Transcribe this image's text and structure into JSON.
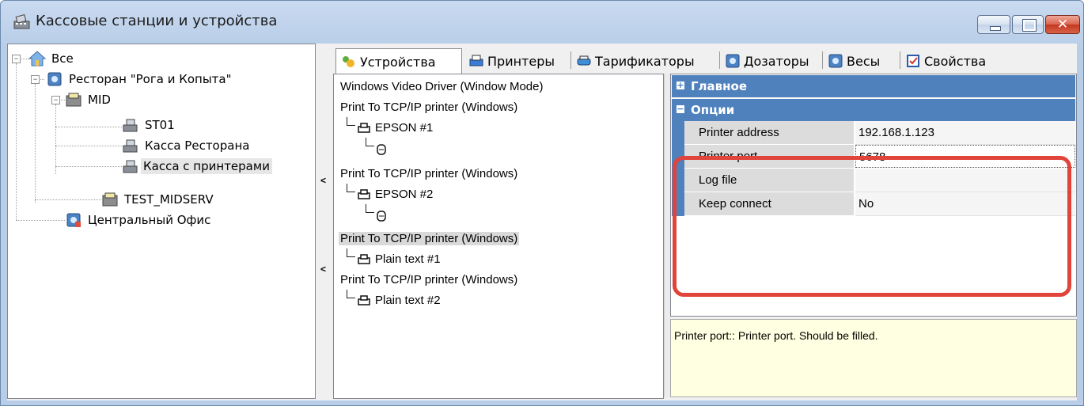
{
  "window": {
    "title": "Кассовые станции и устройства",
    "close_glyph": "✕"
  },
  "tree": {
    "items": [
      {
        "label": "Все"
      },
      {
        "label": "Ресторан \"Рога и Копыта\""
      },
      {
        "label": "MID"
      },
      {
        "label": "ST01"
      },
      {
        "label": "Касса Ресторана"
      },
      {
        "label": "Касса с принтерами"
      },
      {
        "label": "TEST_MIDSERV"
      },
      {
        "label": "Центральный Офис"
      }
    ],
    "expander_minus": "−"
  },
  "tabs": [
    {
      "label": "Устройства"
    },
    {
      "label": "Принтеры"
    },
    {
      "label": "Тарификаторы"
    },
    {
      "label": "Дозаторы"
    },
    {
      "label": "Весы"
    },
    {
      "label": "Свойства"
    }
  ],
  "splitter_arrows": [
    "<",
    "<"
  ],
  "devices": {
    "items": [
      {
        "label": "Windows Video Driver (Window Mode)"
      },
      {
        "label": "Print To TCP/IP printer (Windows)"
      },
      {
        "label": "EPSON #1"
      },
      {
        "label": "Print To TCP/IP printer (Windows)"
      },
      {
        "label": "EPSON #2"
      },
      {
        "label": "Print To TCP/IP printer (Windows)"
      },
      {
        "label": "Plain text #1"
      },
      {
        "label": "Print To TCP/IP printer (Windows)"
      },
      {
        "label": "Plain text #2"
      }
    ]
  },
  "properties": {
    "categories": [
      {
        "label": "Главное",
        "toggle": "+"
      },
      {
        "label": "Опции",
        "toggle": "−"
      }
    ],
    "rows": [
      {
        "name": "Printer address",
        "value": "192.168.1.123"
      },
      {
        "name": "Printer port",
        "value": "5678"
      },
      {
        "name": "Log file",
        "value": ""
      },
      {
        "name": "Keep connect",
        "value": "No"
      }
    ]
  },
  "help": {
    "text": "Printer port:: Printer port. Should be filled."
  },
  "colors": {
    "category_header": "#4f81bd",
    "highlight_border": "#e0443a",
    "help_background": "#ffffe1"
  }
}
